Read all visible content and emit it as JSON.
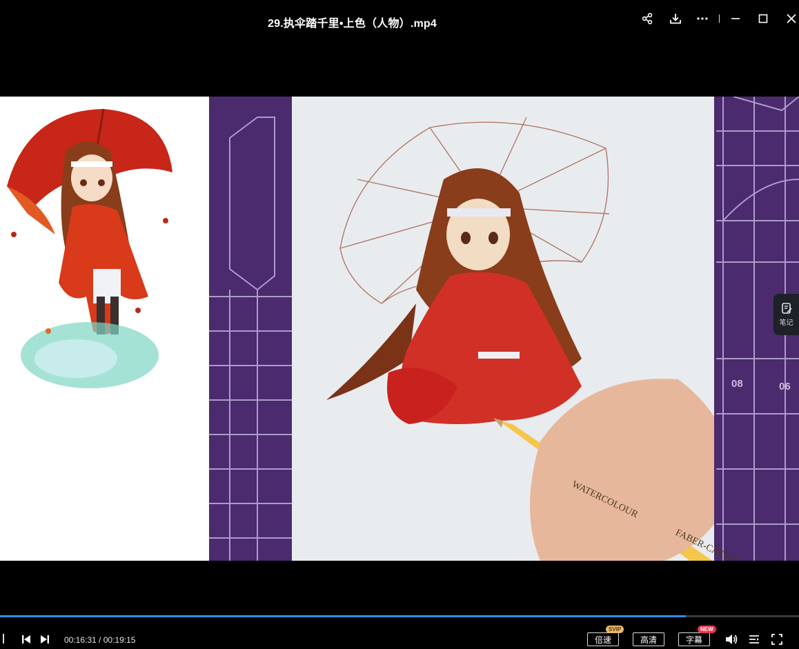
{
  "window": {
    "title": "29.执伞踏千里•上色（人物）.mp4"
  },
  "side_panel": {
    "note_label": "笔记"
  },
  "player": {
    "current_time": "00:16:31",
    "separator": " / ",
    "total_time": "00:19:15",
    "progress": 0.858,
    "speed_label": "倍速",
    "speed_badge": "SVIP",
    "quality_label": "高清",
    "subtitle_label": "字幕",
    "subtitle_badge": "NEW"
  },
  "video_frame": {
    "pencil_text_1": "WATERCOLOUR",
    "pencil_text_2": "FABER-CASTELL",
    "mat_numbers": [
      "08",
      "06"
    ]
  },
  "colors": {
    "accent": "#2b8ef0",
    "mat": "#4b2a6e",
    "badge_svip": "#e8b96a",
    "badge_new": "#e8344e"
  }
}
